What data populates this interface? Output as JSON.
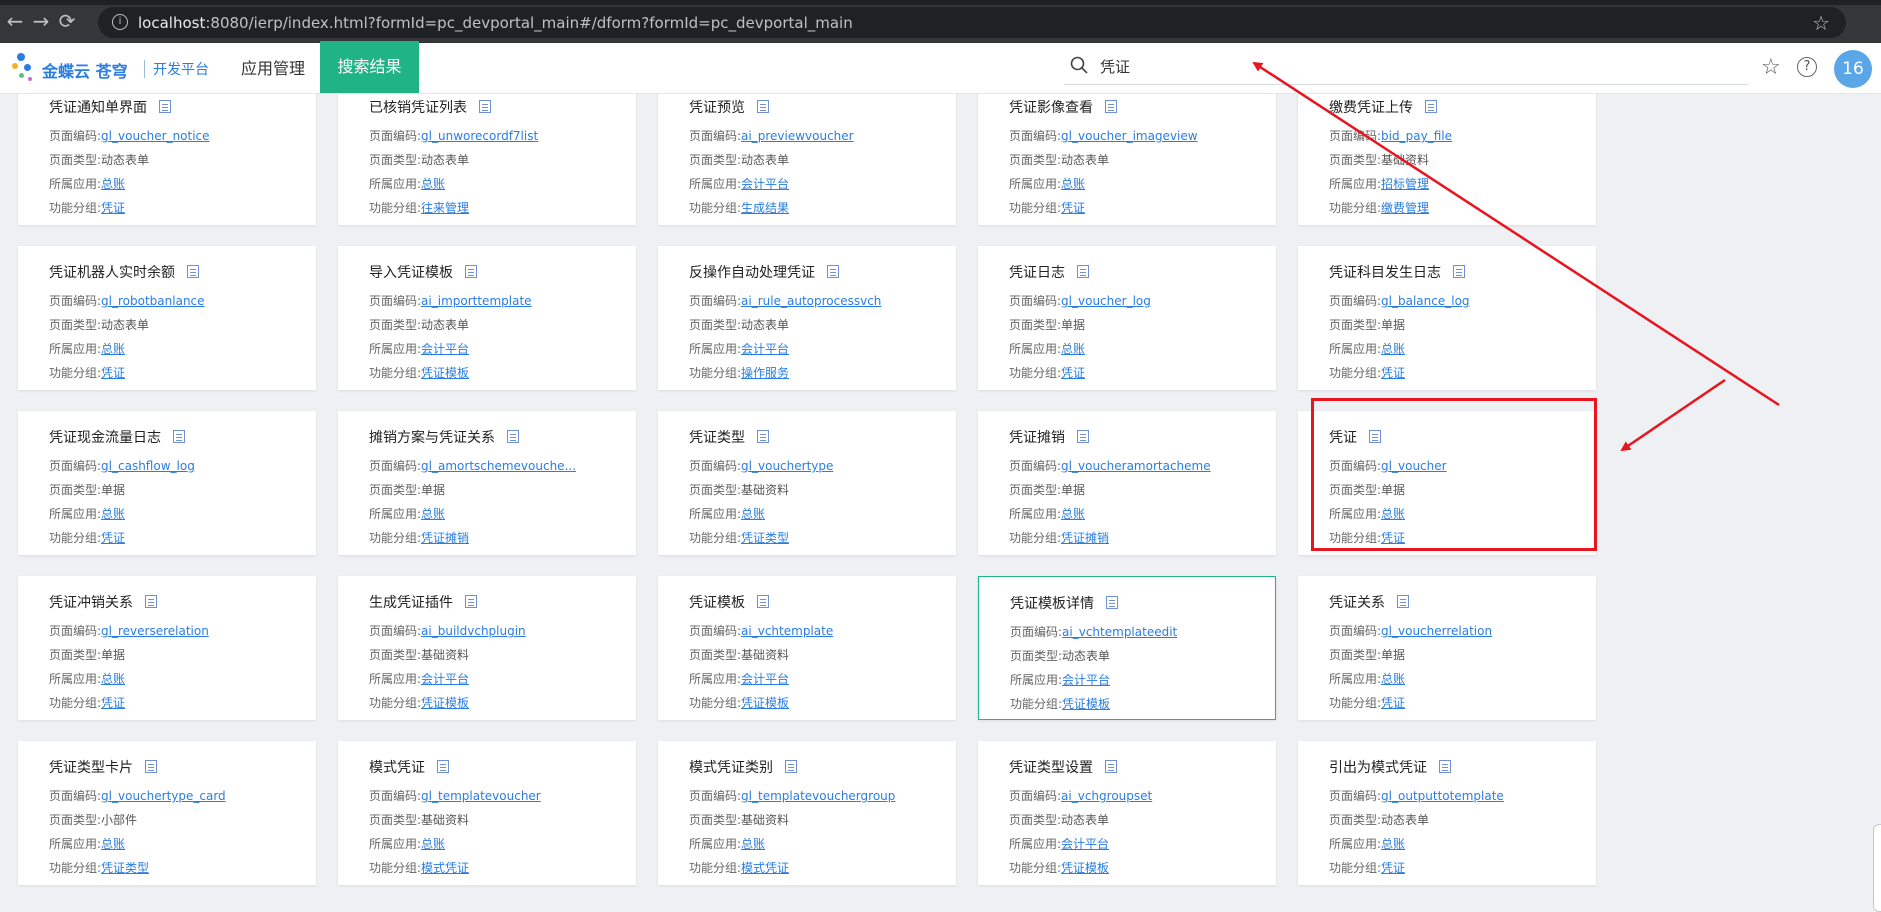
{
  "browser": {
    "url_host": "localhost",
    "url_rest": ":8080/ierp/index.html?formId=pc_devportal_main#/dform?formId=pc_devportal_main"
  },
  "header": {
    "logo_text": "金蝶云 苍穹",
    "logo_sub": "开发平台",
    "nav_app": "应用管理",
    "nav_search": "搜索结果",
    "search_value": "凭证",
    "avatar": "16"
  },
  "cards": [
    {
      "title": "凭证通知单界面",
      "code": "gl_voucher_notice",
      "type": "动态表单",
      "app": "总账",
      "group": "凭证"
    },
    {
      "title": "已核销凭证列表",
      "code": "gl_unworecordf7list",
      "type": "动态表单",
      "app": "总账",
      "group": "往来管理"
    },
    {
      "title": "凭证预览",
      "code": "ai_previewvoucher",
      "type": "动态表单",
      "app": "会计平台",
      "group": "生成结果"
    },
    {
      "title": "凭证影像查看",
      "code": "gl_voucher_imageview",
      "type": "动态表单",
      "app": "总账",
      "group": "凭证"
    },
    {
      "title": "缴费凭证上传",
      "code": "bid_pay_file",
      "type": "基础资料",
      "app": "招标管理",
      "group": "缴费管理"
    },
    {
      "title": "凭证机器人实时余额",
      "code": "gl_robotbanlance",
      "type": "动态表单",
      "app": "总账",
      "group": "凭证"
    },
    {
      "title": "导入凭证模板",
      "code": "ai_importtemplate",
      "type": "动态表单",
      "app": "会计平台",
      "group": "凭证模板"
    },
    {
      "title": "反操作自动处理凭证",
      "code": "ai_rule_autoprocessvch",
      "type": "动态表单",
      "app": "会计平台",
      "group": "操作服务"
    },
    {
      "title": "凭证日志",
      "code": "gl_voucher_log",
      "type": "单据",
      "app": "总账",
      "group": "凭证"
    },
    {
      "title": "凭证科目发生日志",
      "code": "gl_balance_log",
      "type": "单据",
      "app": "总账",
      "group": "凭证"
    },
    {
      "title": "凭证现金流量日志",
      "code": "gl_cashflow_log",
      "type": "单据",
      "app": "总账",
      "group": "凭证"
    },
    {
      "title": "摊销方案与凭证关系",
      "code": "gl_amortschemevouche...",
      "type": "单据",
      "app": "总账",
      "group": "凭证摊销"
    },
    {
      "title": "凭证类型",
      "code": "gl_vouchertype",
      "type": "基础资料",
      "app": "总账",
      "group": "凭证类型"
    },
    {
      "title": "凭证摊销",
      "code": "gl_voucheramortacheme",
      "type": "单据",
      "app": "总账",
      "group": "凭证摊销"
    },
    {
      "title": "凭证",
      "code": "gl_voucher",
      "type": "单据",
      "app": "总账",
      "group": "凭证"
    },
    {
      "title": "凭证冲销关系",
      "code": "gl_reverserelation",
      "type": "单据",
      "app": "总账",
      "group": "凭证"
    },
    {
      "title": "生成凭证插件",
      "code": "ai_buildvchplugin",
      "type": "基础资料",
      "app": "会计平台",
      "group": "凭证模板"
    },
    {
      "title": "凭证模板",
      "code": "ai_vchtemplate",
      "type": "基础资料",
      "app": "会计平台",
      "group": "凭证模板"
    },
    {
      "title": "凭证模板详情",
      "code": "ai_vchtemplateedit",
      "type": "动态表单",
      "app": "会计平台",
      "group": "凭证模板"
    },
    {
      "title": "凭证关系",
      "code": "gl_voucherrelation",
      "type": "单据",
      "app": "总账",
      "group": "凭证"
    },
    {
      "title": "凭证类型卡片",
      "code": "gl_vouchertype_card",
      "type": "小部件",
      "app": "总账",
      "group": "凭证类型"
    },
    {
      "title": "模式凭证",
      "code": "gl_templatevoucher",
      "type": "基础资料",
      "app": "总账",
      "group": "模式凭证"
    },
    {
      "title": "模式凭证类别",
      "code": "gl_templatevouchergroup",
      "type": "基础资料",
      "app": "总账",
      "group": "模式凭证"
    },
    {
      "title": "凭证类型设置",
      "code": "ai_vchgroupset",
      "type": "动态表单",
      "app": "会计平台",
      "group": "凭证模板"
    },
    {
      "title": "引出为模式凭证",
      "code": "gl_outputtotemplate",
      "type": "动态表单",
      "app": "总账",
      "group": "凭证"
    }
  ],
  "labels": {
    "code": "页面编码:",
    "type": "页面类型:",
    "app": "所属应用:",
    "group": "功能分组:"
  },
  "colors": {
    "accent": "#20b384",
    "link": "#2a7de1",
    "annotation": "#e8141e"
  }
}
